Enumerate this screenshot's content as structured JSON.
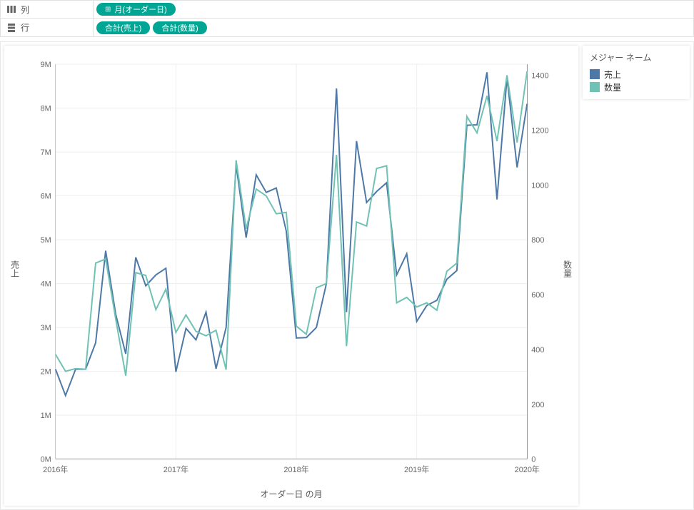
{
  "shelves": {
    "columns_label": "列",
    "rows_label": "行",
    "columns_pills": [
      {
        "label": "月(オーダー日)",
        "icon": "⊞"
      }
    ],
    "rows_pills": [
      {
        "label": "合計(売上)"
      },
      {
        "label": "合計(数量)"
      }
    ]
  },
  "legend": {
    "title": "メジャー ネーム",
    "items": [
      {
        "label": "売上",
        "color": "#4e79a7"
      },
      {
        "label": "数量",
        "color": "#6fc2b4"
      }
    ]
  },
  "axis": {
    "y_left_title": "売上",
    "y_right_title": "数量",
    "x_title": "オーダー日 の月"
  },
  "chart_data": {
    "type": "line",
    "xlabel": "オーダー日 の月",
    "x_tick_labels": [
      "2016年",
      "2017年",
      "2018年",
      "2019年",
      "2020年"
    ],
    "x": [
      "2016-01",
      "2016-02",
      "2016-03",
      "2016-04",
      "2016-05",
      "2016-06",
      "2016-07",
      "2016-08",
      "2016-09",
      "2016-10",
      "2016-11",
      "2016-12",
      "2017-01",
      "2017-02",
      "2017-03",
      "2017-04",
      "2017-05",
      "2017-06",
      "2017-07",
      "2017-08",
      "2017-09",
      "2017-10",
      "2017-11",
      "2017-12",
      "2018-01",
      "2018-02",
      "2018-03",
      "2018-04",
      "2018-05",
      "2018-06",
      "2018-07",
      "2018-08",
      "2018-09",
      "2018-10",
      "2018-11",
      "2018-12",
      "2019-01",
      "2019-02",
      "2019-03",
      "2019-04",
      "2019-05",
      "2019-06",
      "2019-07",
      "2019-08",
      "2019-09",
      "2019-10",
      "2019-11",
      "2019-12"
    ],
    "series": [
      {
        "name": "売上",
        "axis": "left",
        "color": "#4e79a7",
        "ylim": [
          0,
          9000000
        ],
        "ylabel": "売上",
        "y_ticks": [
          0,
          1000000,
          2000000,
          3000000,
          4000000,
          5000000,
          6000000,
          7000000,
          8000000,
          9000000
        ],
        "y_tick_labels": [
          "0M",
          "1M",
          "2M",
          "3M",
          "4M",
          "5M",
          "6M",
          "7M",
          "8M",
          "9M"
        ],
        "values": [
          2050000,
          1450000,
          2050000,
          2050000,
          2650000,
          4750000,
          3300000,
          2400000,
          4600000,
          3950000,
          4200000,
          4350000,
          1990000,
          2980000,
          2720000,
          3350000,
          2060000,
          3000000,
          6700000,
          5050000,
          6480000,
          6080000,
          6180000,
          5200000,
          2760000,
          2770000,
          3000000,
          4000000,
          8450000,
          3350000,
          7250000,
          5850000,
          6100000,
          6300000,
          4200000,
          4680000,
          3140000,
          3500000,
          3620000,
          4100000,
          4300000,
          7610000,
          7620000,
          8820000,
          5920000,
          8700000,
          6650000,
          8100000
        ]
      },
      {
        "name": "数量",
        "axis": "right",
        "color": "#6fc2b4",
        "ylim": [
          0,
          1440
        ],
        "ylabel": "数量",
        "y_ticks": [
          0,
          200,
          400,
          600,
          800,
          1000,
          1200,
          1400
        ],
        "y_tick_labels": [
          "0",
          "200",
          "400",
          "600",
          "800",
          "1000",
          "1200",
          "1400"
        ],
        "values": [
          382,
          320,
          330,
          328,
          715,
          730,
          510,
          304,
          680,
          670,
          545,
          620,
          462,
          526,
          466,
          450,
          470,
          326,
          1090,
          840,
          985,
          960,
          895,
          900,
          485,
          455,
          625,
          640,
          1110,
          412,
          865,
          850,
          1060,
          1070,
          570,
          590,
          555,
          570,
          543,
          685,
          715,
          1250,
          1190,
          1325,
          1160,
          1400,
          1155,
          1415
        ]
      }
    ]
  }
}
